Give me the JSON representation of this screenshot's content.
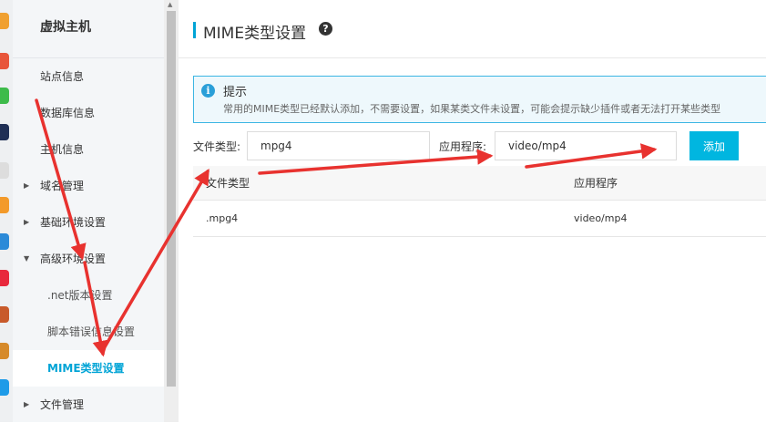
{
  "sidebar": {
    "title": "虚拟主机",
    "items": [
      {
        "label": "站点信息"
      },
      {
        "label": "数据库信息"
      },
      {
        "label": "主机信息"
      },
      {
        "label": "域名管理"
      },
      {
        "label": "基础环境设置"
      },
      {
        "label": "高级环境设置"
      },
      {
        "label": ".net版本设置"
      },
      {
        "label": "脚本错误信息设置"
      },
      {
        "label": "MIME类型设置"
      },
      {
        "label": "文件管理"
      }
    ]
  },
  "header": {
    "title": "MIME类型设置",
    "help_icon": "question-circle-icon",
    "help_glyph": "?"
  },
  "tip": {
    "icon": "info-icon",
    "icon_glyph": "i",
    "title": "提示",
    "text": "常用的MIME类型已经默认添加，不需要设置，如果某类文件未设置，可能会提示缺少插件或者无法打开某些类型"
  },
  "form": {
    "file_type_label": "文件类型:",
    "file_type_value": "mpg4",
    "app_label": "应用程序:",
    "app_value": "video/mp4",
    "add_label": "添加"
  },
  "table": {
    "headers": [
      "文件类型",
      "应用程序"
    ],
    "rows": [
      [
        ".mpg4",
        "video/mp4"
      ]
    ]
  },
  "colors": {
    "accent": "#00a4d6",
    "button": "#00b6e0",
    "annotation_arrow": "#e8322f",
    "tip_border": "#3cb6e3"
  }
}
